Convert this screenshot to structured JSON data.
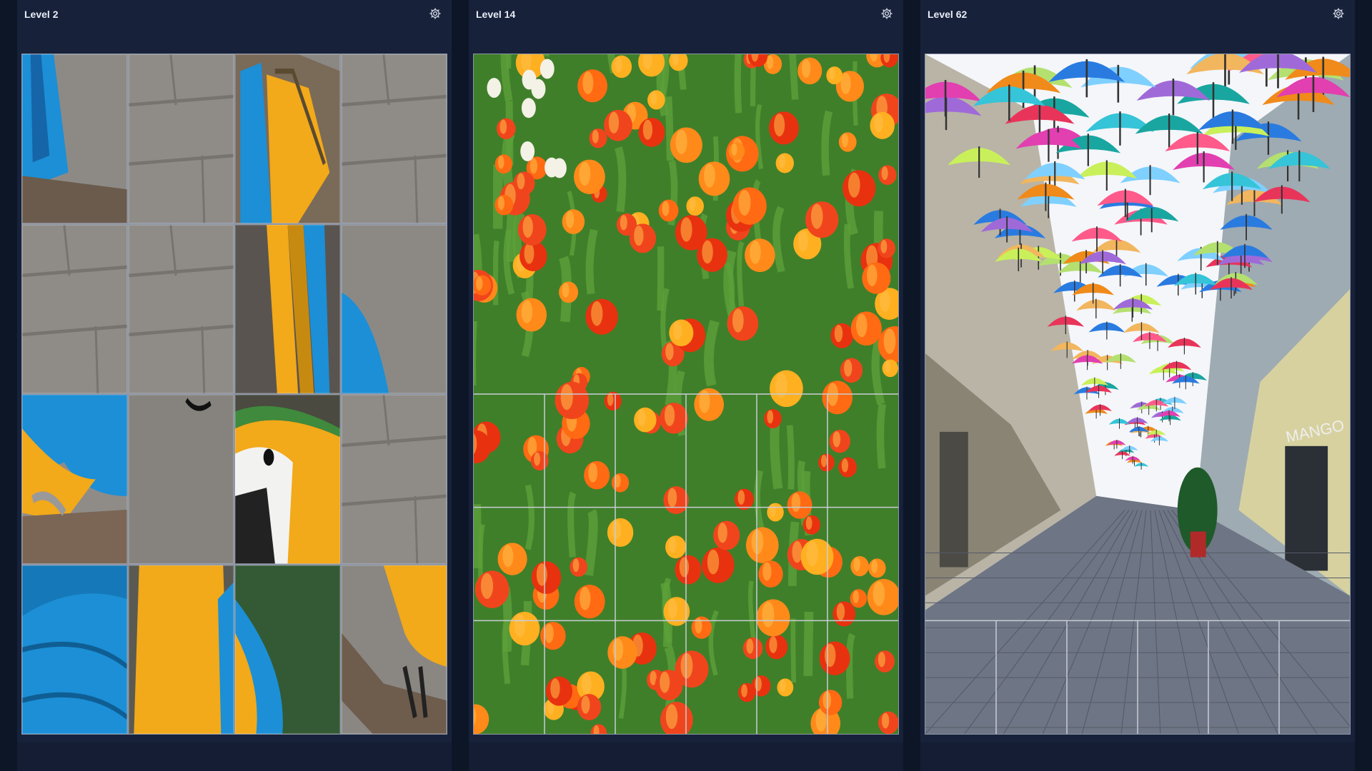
{
  "puzzles": [
    {
      "level_label": "Level 2",
      "settings_icon": "gear-icon",
      "subject": "macaw",
      "grid": {
        "cols": 4,
        "rows": 4
      },
      "tiles": [
        "wing-blue",
        "stone",
        "macaw-head-top",
        "stone",
        "stone",
        "stone",
        "tail-feathers",
        "wing-blue-edge",
        "belly-perch",
        "stone-empty",
        "macaw-face",
        "stone",
        "feathers-blue",
        "feathers-yellow",
        "wing-green-bg",
        "branch-claw"
      ]
    },
    {
      "level_label": "Level 14",
      "settings_icon": "gear-icon",
      "subject": "tulips",
      "grid": {
        "cols": 6,
        "rows": 6
      },
      "solved_region": {
        "cols": 6,
        "rows": 3
      },
      "tiles_count": 18
    },
    {
      "level_label": "Level 62",
      "settings_icon": "gear-icon",
      "subject": "umbrella street",
      "grid": {
        "cols": 6,
        "rows": 6
      },
      "solved_region": {
        "cols": 6,
        "rows": 5
      },
      "tiles_count": 6
    }
  ],
  "colors": {
    "background": "#0c1627",
    "panel": "#17213a",
    "text": "#e8edf6",
    "grid_line": "#8e97a8",
    "macaw_blue": "#1c8fd6",
    "macaw_yellow": "#f2a91a",
    "stone": "#8f8c88",
    "tulip_red": "#f0451c",
    "tulip_orange": "#ff8a1a",
    "leaf_green": "#3e8a2a",
    "sky": "#f4f6fa",
    "cobblestone": "#6e7584"
  }
}
